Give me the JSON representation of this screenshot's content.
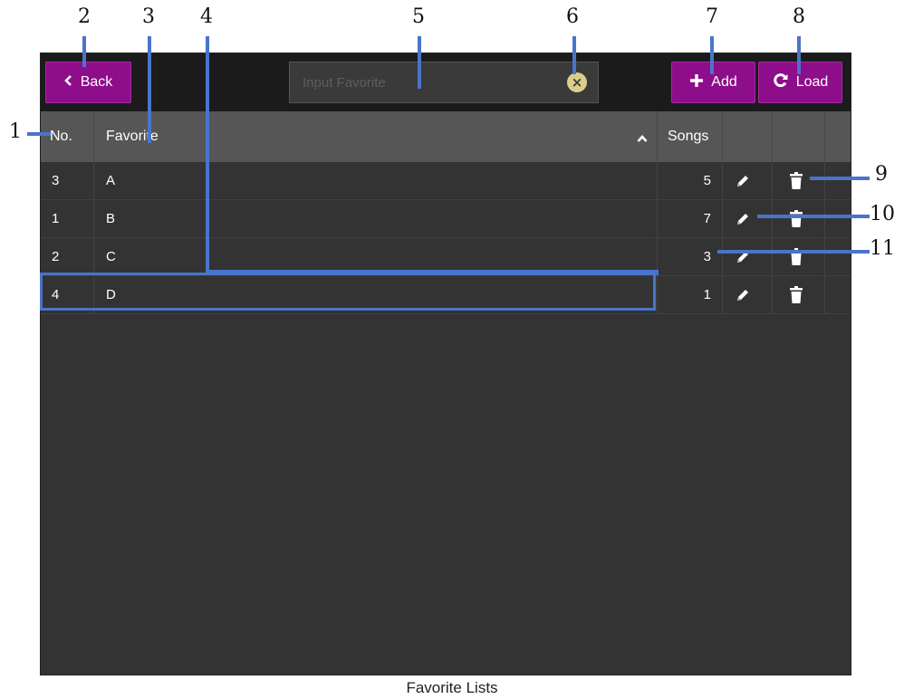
{
  "toolbar": {
    "back_label": "Back",
    "search_placeholder": "Input Favorite",
    "add_label": "Add",
    "load_label": "Load"
  },
  "table": {
    "columns": [
      "No.",
      "Favorite",
      "Songs"
    ],
    "sort_indicator": "ascending",
    "rows": [
      {
        "no": "3",
        "favorite": "A",
        "songs": "5"
      },
      {
        "no": "1",
        "favorite": "B",
        "songs": "7"
      },
      {
        "no": "2",
        "favorite": "C",
        "songs": "3"
      },
      {
        "no": "4",
        "favorite": "D",
        "songs": "1"
      }
    ]
  },
  "callouts": [
    "1",
    "2",
    "3",
    "4",
    "5",
    "6",
    "7",
    "8",
    "9",
    "10",
    "11"
  ],
  "caption": "Favorite Lists",
  "colors": {
    "accent_button": "#8e0d8a",
    "callout_line": "#4a74c9",
    "app_bg": "#333333",
    "header_bg": "#565656"
  },
  "icons": [
    "chevron-left-icon",
    "plus-icon",
    "refresh-icon",
    "clear-icon",
    "sort-up-icon",
    "pencil-icon",
    "trash-icon"
  ]
}
